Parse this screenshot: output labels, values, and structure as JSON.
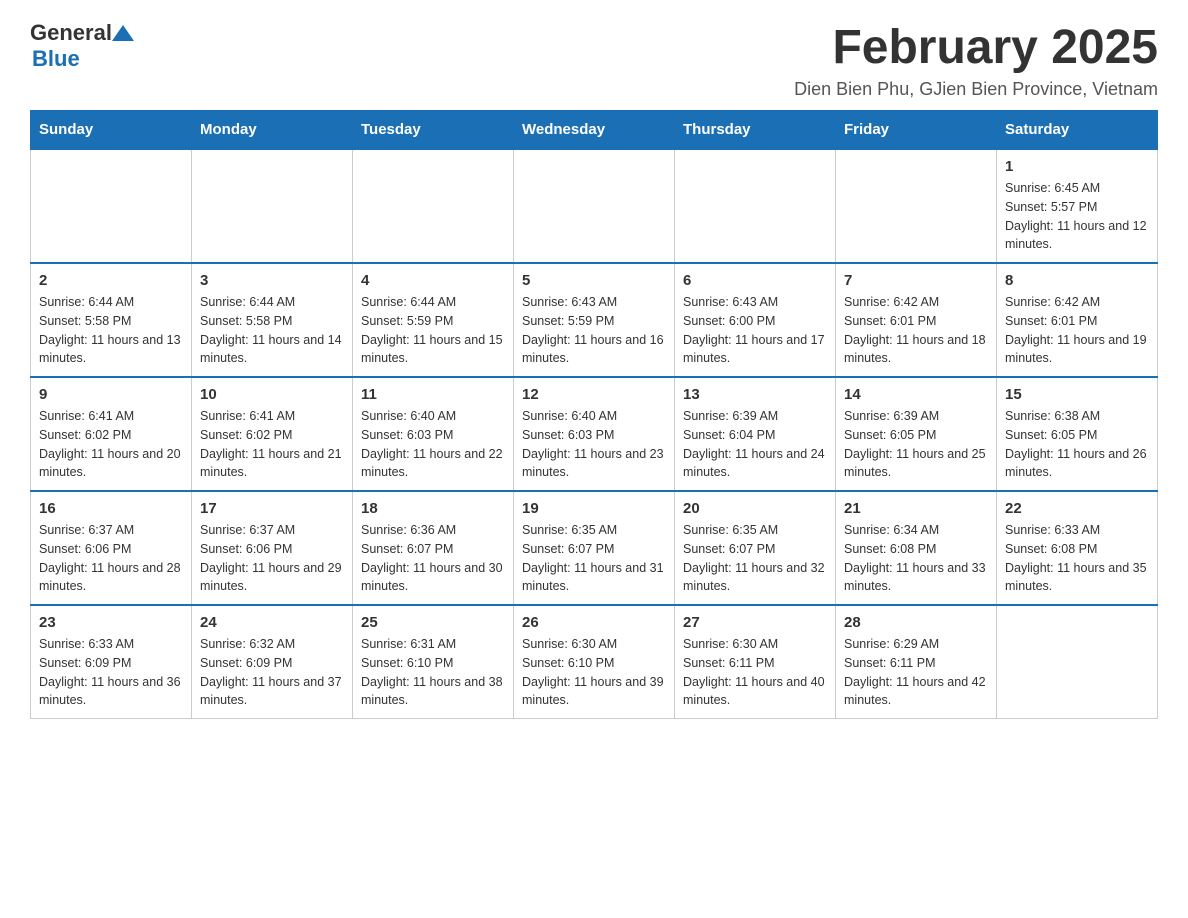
{
  "logo": {
    "general": "General",
    "blue": "Blue"
  },
  "title": "February 2025",
  "subtitle": "Dien Bien Phu, GJien Bien Province, Vietnam",
  "weekdays": [
    "Sunday",
    "Monday",
    "Tuesday",
    "Wednesday",
    "Thursday",
    "Friday",
    "Saturday"
  ],
  "weeks": [
    [
      {
        "day": "",
        "info": ""
      },
      {
        "day": "",
        "info": ""
      },
      {
        "day": "",
        "info": ""
      },
      {
        "day": "",
        "info": ""
      },
      {
        "day": "",
        "info": ""
      },
      {
        "day": "",
        "info": ""
      },
      {
        "day": "1",
        "info": "Sunrise: 6:45 AM\nSunset: 5:57 PM\nDaylight: 11 hours and 12 minutes."
      }
    ],
    [
      {
        "day": "2",
        "info": "Sunrise: 6:44 AM\nSunset: 5:58 PM\nDaylight: 11 hours and 13 minutes."
      },
      {
        "day": "3",
        "info": "Sunrise: 6:44 AM\nSunset: 5:58 PM\nDaylight: 11 hours and 14 minutes."
      },
      {
        "day": "4",
        "info": "Sunrise: 6:44 AM\nSunset: 5:59 PM\nDaylight: 11 hours and 15 minutes."
      },
      {
        "day": "5",
        "info": "Sunrise: 6:43 AM\nSunset: 5:59 PM\nDaylight: 11 hours and 16 minutes."
      },
      {
        "day": "6",
        "info": "Sunrise: 6:43 AM\nSunset: 6:00 PM\nDaylight: 11 hours and 17 minutes."
      },
      {
        "day": "7",
        "info": "Sunrise: 6:42 AM\nSunset: 6:01 PM\nDaylight: 11 hours and 18 minutes."
      },
      {
        "day": "8",
        "info": "Sunrise: 6:42 AM\nSunset: 6:01 PM\nDaylight: 11 hours and 19 minutes."
      }
    ],
    [
      {
        "day": "9",
        "info": "Sunrise: 6:41 AM\nSunset: 6:02 PM\nDaylight: 11 hours and 20 minutes."
      },
      {
        "day": "10",
        "info": "Sunrise: 6:41 AM\nSunset: 6:02 PM\nDaylight: 11 hours and 21 minutes."
      },
      {
        "day": "11",
        "info": "Sunrise: 6:40 AM\nSunset: 6:03 PM\nDaylight: 11 hours and 22 minutes."
      },
      {
        "day": "12",
        "info": "Sunrise: 6:40 AM\nSunset: 6:03 PM\nDaylight: 11 hours and 23 minutes."
      },
      {
        "day": "13",
        "info": "Sunrise: 6:39 AM\nSunset: 6:04 PM\nDaylight: 11 hours and 24 minutes."
      },
      {
        "day": "14",
        "info": "Sunrise: 6:39 AM\nSunset: 6:05 PM\nDaylight: 11 hours and 25 minutes."
      },
      {
        "day": "15",
        "info": "Sunrise: 6:38 AM\nSunset: 6:05 PM\nDaylight: 11 hours and 26 minutes."
      }
    ],
    [
      {
        "day": "16",
        "info": "Sunrise: 6:37 AM\nSunset: 6:06 PM\nDaylight: 11 hours and 28 minutes."
      },
      {
        "day": "17",
        "info": "Sunrise: 6:37 AM\nSunset: 6:06 PM\nDaylight: 11 hours and 29 minutes."
      },
      {
        "day": "18",
        "info": "Sunrise: 6:36 AM\nSunset: 6:07 PM\nDaylight: 11 hours and 30 minutes."
      },
      {
        "day": "19",
        "info": "Sunrise: 6:35 AM\nSunset: 6:07 PM\nDaylight: 11 hours and 31 minutes."
      },
      {
        "day": "20",
        "info": "Sunrise: 6:35 AM\nSunset: 6:07 PM\nDaylight: 11 hours and 32 minutes."
      },
      {
        "day": "21",
        "info": "Sunrise: 6:34 AM\nSunset: 6:08 PM\nDaylight: 11 hours and 33 minutes."
      },
      {
        "day": "22",
        "info": "Sunrise: 6:33 AM\nSunset: 6:08 PM\nDaylight: 11 hours and 35 minutes."
      }
    ],
    [
      {
        "day": "23",
        "info": "Sunrise: 6:33 AM\nSunset: 6:09 PM\nDaylight: 11 hours and 36 minutes."
      },
      {
        "day": "24",
        "info": "Sunrise: 6:32 AM\nSunset: 6:09 PM\nDaylight: 11 hours and 37 minutes."
      },
      {
        "day": "25",
        "info": "Sunrise: 6:31 AM\nSunset: 6:10 PM\nDaylight: 11 hours and 38 minutes."
      },
      {
        "day": "26",
        "info": "Sunrise: 6:30 AM\nSunset: 6:10 PM\nDaylight: 11 hours and 39 minutes."
      },
      {
        "day": "27",
        "info": "Sunrise: 6:30 AM\nSunset: 6:11 PM\nDaylight: 11 hours and 40 minutes."
      },
      {
        "day": "28",
        "info": "Sunrise: 6:29 AM\nSunset: 6:11 PM\nDaylight: 11 hours and 42 minutes."
      },
      {
        "day": "",
        "info": ""
      }
    ]
  ]
}
